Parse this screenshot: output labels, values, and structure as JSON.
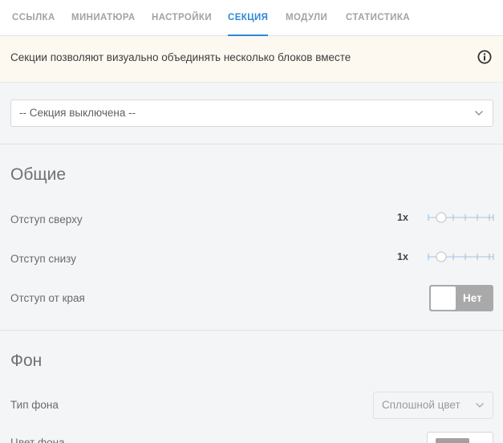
{
  "tabs": [
    {
      "label": "ССЫЛКА",
      "active": false
    },
    {
      "label": "МИНИАТЮРА",
      "active": false
    },
    {
      "label": "НАСТРОЙКИ",
      "active": false
    },
    {
      "label": "СЕКЦИЯ",
      "active": true
    },
    {
      "label": "МОДУЛИ",
      "active": false
    },
    {
      "label": "СТАТИСТИКА",
      "active": false
    }
  ],
  "notice": {
    "text": "Секции позволяют визуально объединять несколько блоков вместе",
    "icon": "info-icon"
  },
  "section_select": {
    "value": "-- Секция выключена --",
    "icon": "chevron-down-icon"
  },
  "general": {
    "title": "Общие",
    "padding_top": {
      "label": "Отступ сверху",
      "multiplier": "1x",
      "level_index": 1,
      "steps": 7
    },
    "padding_bottom": {
      "label": "Отступ снизу",
      "multiplier": "1x",
      "level_index": 1,
      "steps": 7
    },
    "edge_padding": {
      "label": "Отступ от края",
      "toggle_label": "Нет",
      "enabled": false
    }
  },
  "background": {
    "title": "Фон",
    "type": {
      "label": "Тип фона",
      "value": "Сплошной цвет"
    },
    "color": {
      "label": "Цвет фона",
      "swatch": "#a0a0a0"
    }
  },
  "colors": {
    "accent": "#2e87d9",
    "toggle_off": "#a9a9a9",
    "notice_bg": "#fdf9f1",
    "slider": "#9ec6ea"
  }
}
